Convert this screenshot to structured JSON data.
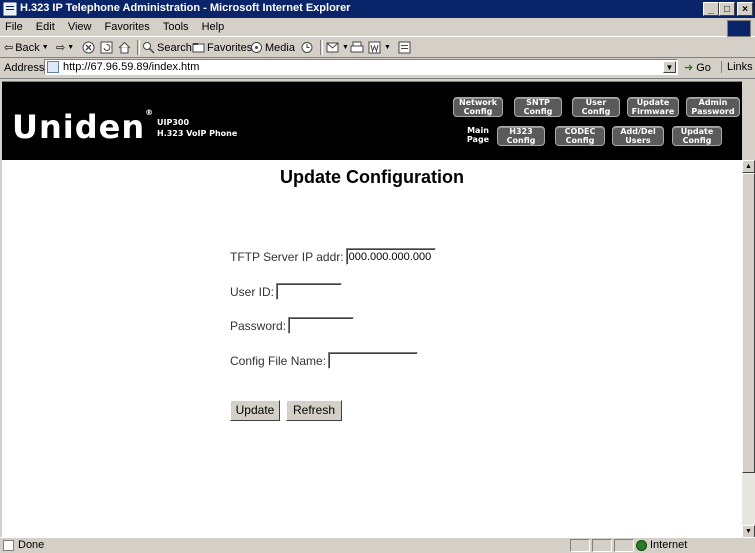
{
  "window": {
    "title": "H.323 IP Telephone Administration - Microsoft Internet Explorer",
    "minimize": "_",
    "maximize": "□",
    "close": "×"
  },
  "menu": [
    "File",
    "Edit",
    "View",
    "Favorites",
    "Tools",
    "Help"
  ],
  "toolbar": {
    "back": "Back",
    "search": "Search",
    "favorites": "Favorites",
    "media": "Media"
  },
  "address": {
    "label": "Address",
    "url": "http://67.96.59.89/index.htm",
    "go": "Go",
    "links": "Links »"
  },
  "header": {
    "logo": "Uniden",
    "model_line1": "UIP300",
    "model_line2": "H.323 VoIP Phone",
    "nav_top": [
      {
        "line1": "Network",
        "line2": "Config"
      },
      {
        "line1": "SNTP",
        "line2": "Config"
      },
      {
        "line1": "User",
        "line2": "Config"
      },
      {
        "line1": "Update",
        "line2": "Firmware"
      },
      {
        "line1": "Admin",
        "line2": "Password"
      }
    ],
    "nav_main": {
      "line1": "Main",
      "line2": "Page"
    },
    "nav_bottom": [
      {
        "line1": "H323",
        "line2": "Config"
      },
      {
        "line1": "CODEC",
        "line2": "Config"
      },
      {
        "line1": "Add/Del",
        "line2": "Users"
      },
      {
        "line1": "Update",
        "line2": "Config"
      }
    ]
  },
  "page": {
    "title": "Update Configuration",
    "fields": {
      "tftp_label": "TFTP Server IP addr:",
      "tftp_value": "000.000.000.000",
      "user_label": "User ID:",
      "user_value": "",
      "password_label": "Password:",
      "password_value": "",
      "config_label": "Config File Name:",
      "config_value": ""
    },
    "buttons": {
      "update": "Update",
      "refresh": "Refresh"
    }
  },
  "status": {
    "text": "Done",
    "zone": "Internet"
  }
}
